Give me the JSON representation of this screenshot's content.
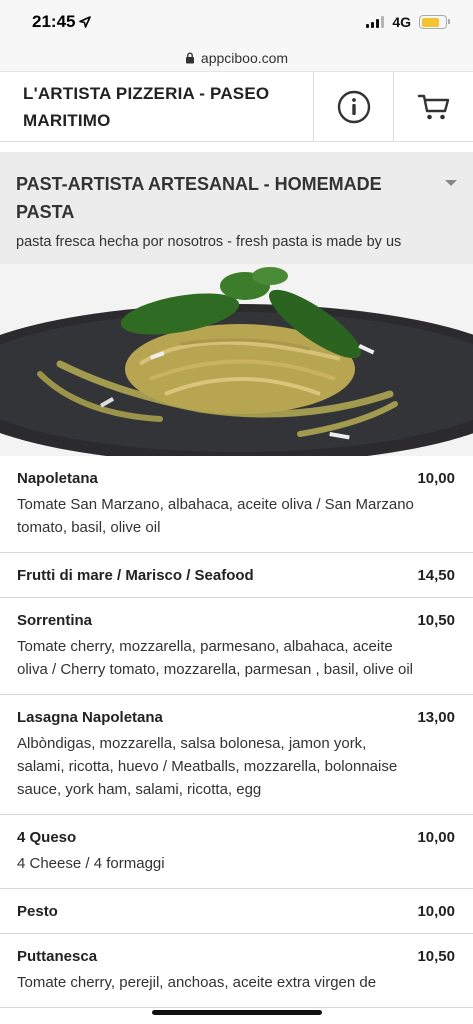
{
  "status": {
    "time": "21:45",
    "network": "4G"
  },
  "browser": {
    "url": "appciboo.com"
  },
  "header": {
    "title": "L'ARTISTA PIZZERIA - PASEO MARITIMO",
    "info_icon": "info-icon",
    "cart_icon": "cart-icon"
  },
  "section": {
    "title": "PAST-ARTISTA ARTESANAL - HOMEMADE PASTA",
    "subtitle": "pasta fresca hecha por nosotros - fresh pasta is made by us"
  },
  "items": [
    {
      "name": "Napoletana",
      "price": "10,00",
      "desc": "Tomate San Marzano, albahaca, aceite oliva / San Marzano tomato, basil, olive oil"
    },
    {
      "name": "Frutti di mare / Marisco / Seafood",
      "price": "14,50",
      "desc": ""
    },
    {
      "name": "Sorrentina",
      "price": "10,50",
      "desc": "Tomate cherry, mozzarella, parmesano, albahaca, aceite oliva / Cherry tomato, mozzarella, parmesan , basil, olive oil"
    },
    {
      "name": "Lasagna Napoletana",
      "price": "13,00",
      "desc": "Albòndigas, mozzarella, salsa bolonesa, jamon york, salami, ricotta, huevo / Meatballs, mozzarella, bolonnaise sauce, york ham, salami, ricotta, egg"
    },
    {
      "name": "4 Queso",
      "price": "10,00",
      "desc": "4 Cheese / 4 formaggi"
    },
    {
      "name": "Pesto",
      "price": "10,00",
      "desc": ""
    },
    {
      "name": "Puttanesca",
      "price": "10,50",
      "desc": "Tomate cherry, perejil, anchoas, aceite extra virgen de"
    }
  ]
}
